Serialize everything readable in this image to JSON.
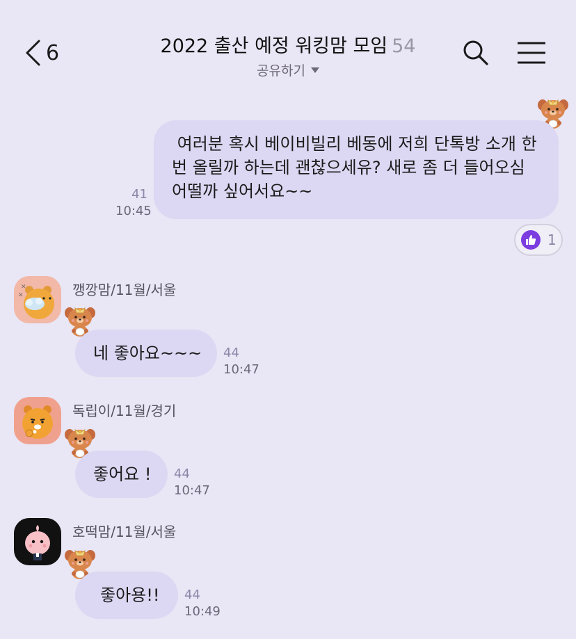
{
  "header": {
    "back_count": "6",
    "title": "2022 출산 예정 워킹맘 모임",
    "member_count": "54",
    "share_label": "공유하기"
  },
  "messages": [
    {
      "sender": "me",
      "text_lines": [
        " 여러분 혹시 베이비빌리 베동에 저희 단톡방 소개 한",
        "번 올릴까 하는데 괜찮으세유? 새로 좀 더 들어오심",
        "어떨까 싶어서요~~"
      ],
      "unread": "41",
      "time": "10:45",
      "reaction": {
        "icon": "thumbs-up-icon",
        "count": "1"
      }
    },
    {
      "sender": "깽깡맘/11월/서울",
      "text": "네 좋아요~~~",
      "unread": "44",
      "time": "10:47"
    },
    {
      "sender": "독립이/11월/경기",
      "text": "좋어요 !",
      "unread": "44",
      "time": "10:47"
    },
    {
      "sender": "호떡맘/11월/서울",
      "text": "좋아용!!",
      "unread": "44",
      "time": "10:49"
    }
  ],
  "colors": {
    "background": "#e9e6f5",
    "bubble": "#dcd8f3",
    "reaction_accent": "#7b3de0"
  }
}
